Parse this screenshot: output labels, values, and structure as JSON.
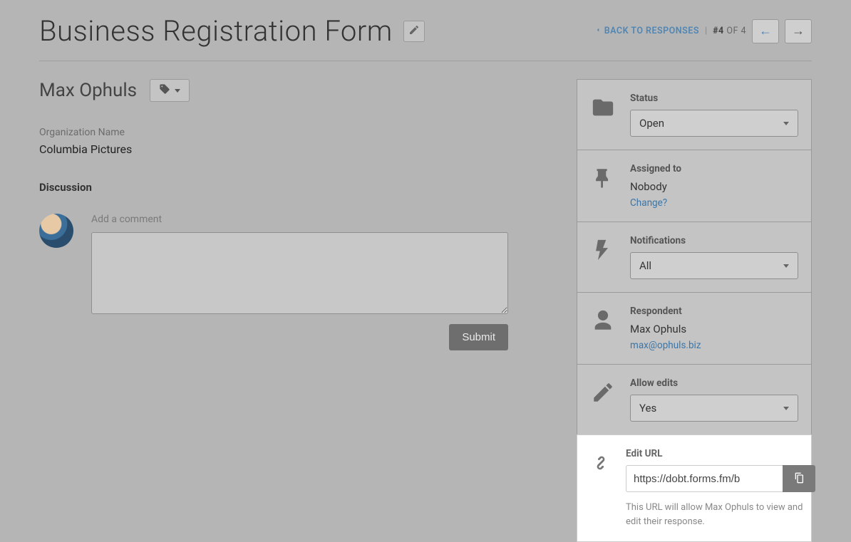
{
  "header": {
    "title": "Business Registration Form",
    "back_label": "BACK TO RESPONSES",
    "counter_current": "#4",
    "counter_of": "OF",
    "counter_total": "4"
  },
  "respondent_row": {
    "name": "Max Ophuls"
  },
  "field": {
    "label": "Organization Name",
    "value": "Columbia Pictures"
  },
  "discussion": {
    "title": "Discussion",
    "comment_label": "Add a comment",
    "submit": "Submit"
  },
  "sidebar": {
    "status": {
      "label": "Status",
      "value": "Open"
    },
    "assigned": {
      "label": "Assigned to",
      "value": "Nobody",
      "change": "Change?"
    },
    "notifications": {
      "label": "Notifications",
      "value": "All"
    },
    "respondent": {
      "label": "Respondent",
      "name": "Max Ophuls",
      "email": "max@ophuls.biz"
    },
    "allow_edits": {
      "label": "Allow edits",
      "value": "Yes"
    },
    "edit_url": {
      "label": "Edit URL",
      "value": "https://dobt.forms.fm/b",
      "note": "This URL will allow Max Ophuls to view and edit their response."
    }
  }
}
